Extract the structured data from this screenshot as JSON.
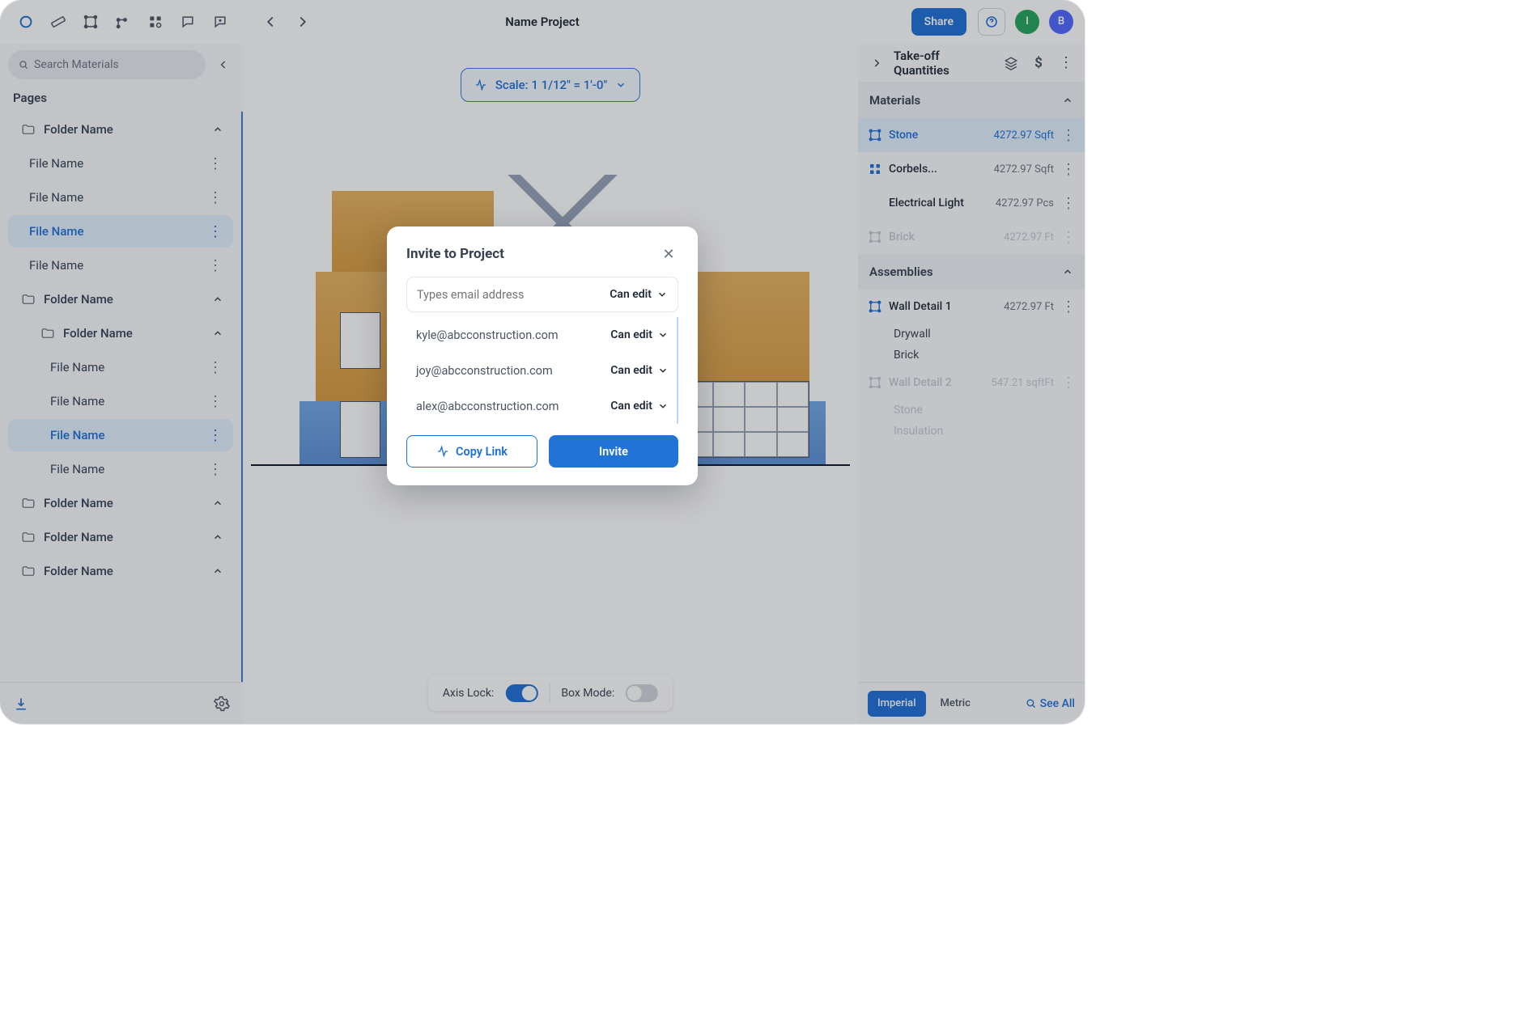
{
  "header": {
    "project_title": "Name Project",
    "share_label": "Share",
    "avatars": [
      {
        "initial": "I",
        "color": "#22a55a"
      },
      {
        "initial": "B",
        "color": "#4f66ff"
      }
    ]
  },
  "sidebar": {
    "search_placeholder": "Search Materials",
    "pages_label": "Pages",
    "folders": [
      {
        "name": "Folder Name",
        "files": [
          {
            "name": "File Name",
            "selected": false
          },
          {
            "name": "File Name",
            "selected": false
          },
          {
            "name": "File Name",
            "selected": true
          },
          {
            "name": "File Name",
            "selected": false
          }
        ]
      },
      {
        "name": "Folder Name",
        "subfolders": [
          {
            "name": "Folder Name",
            "files": [
              {
                "name": "File Name",
                "selected": false
              },
              {
                "name": "File Name",
                "selected": false
              },
              {
                "name": "File Name",
                "selected": true
              },
              {
                "name": "File Name",
                "selected": false
              }
            ]
          }
        ]
      },
      {
        "name": "Folder Name",
        "files": []
      },
      {
        "name": "Folder Name",
        "files": []
      },
      {
        "name": "Folder Name",
        "files": []
      }
    ]
  },
  "canvas": {
    "scale_label": "Scale: 1 1/12\" = 1'-0\"",
    "axis_lock_label": "Axis Lock:",
    "axis_lock_on": true,
    "box_mode_label": "Box Mode:",
    "box_mode_on": false
  },
  "right_panel": {
    "title": "Take-off Quantities",
    "sections": {
      "materials": {
        "label": "Materials",
        "items": [
          {
            "name": "Stone",
            "value": "4272.97 Sqft",
            "icon": "area",
            "selected": true,
            "disabled": false
          },
          {
            "name": "Corbels...",
            "value": "4272.97 Sqft",
            "icon": "grid",
            "selected": false,
            "disabled": false
          },
          {
            "name": "Electrical Light",
            "value": "4272.97 Pcs",
            "icon": "",
            "selected": false,
            "disabled": false
          },
          {
            "name": "Brick",
            "value": "4272.97 Ft",
            "icon": "area",
            "selected": false,
            "disabled": true
          }
        ]
      },
      "assemblies": {
        "label": "Assemblies",
        "items": [
          {
            "name": "Wall Detail 1",
            "value": "4272.97 Ft",
            "disabled": false,
            "subs": [
              "Drywall",
              "Brick"
            ]
          },
          {
            "name": "Wall Detail 2",
            "value": "547.21 sqftFt",
            "disabled": true,
            "subs": [
              "Stone",
              "Insulation"
            ]
          }
        ]
      }
    },
    "footer": {
      "imperial": "Imperial",
      "metric": "Metric",
      "see_all": "See All"
    }
  },
  "modal": {
    "title": "Invite to Project",
    "email_placeholder": "Types email address",
    "perm_label": "Can edit",
    "invitees": [
      {
        "email": "kyle@abcconstruction.com",
        "perm": "Can edit"
      },
      {
        "email": "joy@abcconstruction.com",
        "perm": "Can edit"
      },
      {
        "email": "alex@abcconstruction.com",
        "perm": "Can edit"
      }
    ],
    "copy_link_label": "Copy Link",
    "invite_label": "Invite"
  }
}
